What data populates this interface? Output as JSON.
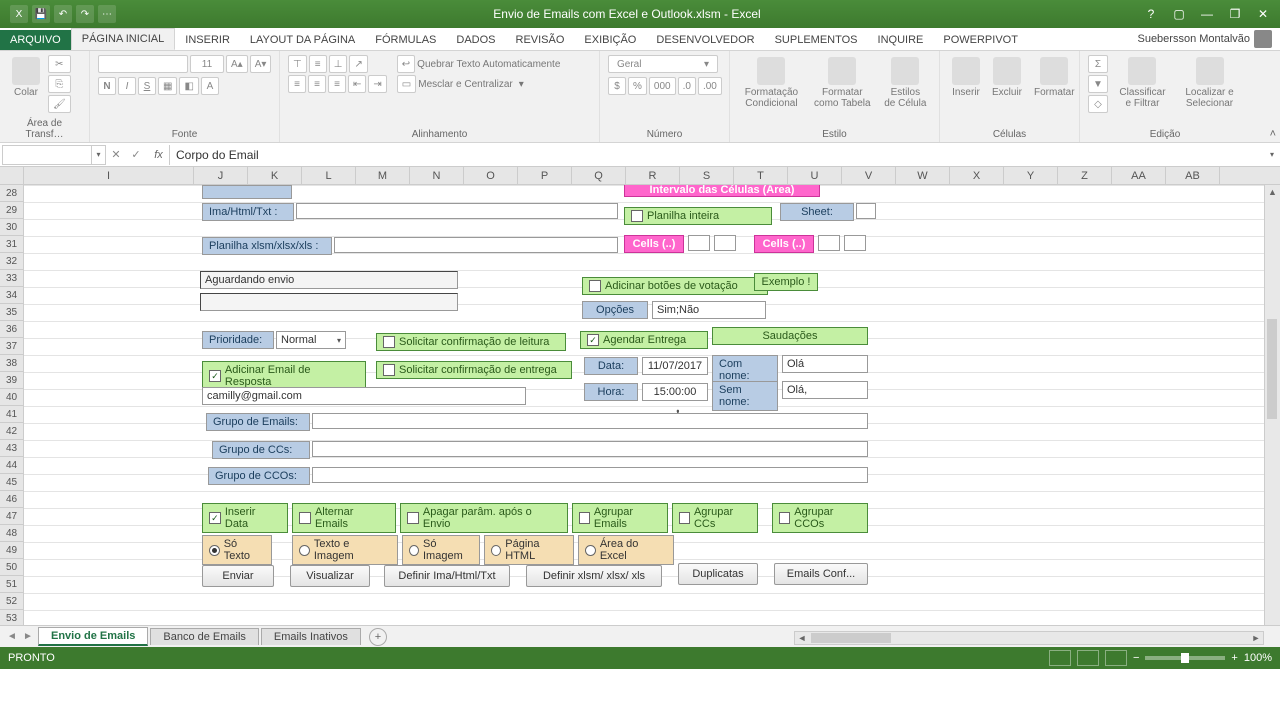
{
  "title": "Envio de Emails com Excel e Outlook.xlsm - Excel",
  "user": "Suebersson Montalvão",
  "tabs": {
    "file": "ARQUIVO",
    "items": [
      "PÁGINA INICIAL",
      "INSERIR",
      "LAYOUT DA PÁGINA",
      "FÓRMULAS",
      "DADOS",
      "REVISÃO",
      "EXIBIÇÃO",
      "DESENVOLVEDOR",
      "SUPLEMENTOS",
      "INQUIRE",
      "POWERPIVOT"
    ],
    "active": 0
  },
  "ribbon": {
    "clipboard": {
      "label": "Área de Transf…",
      "paste": "Colar"
    },
    "font": {
      "label": "Fonte",
      "size": "11"
    },
    "alignment": {
      "label": "Alinhamento",
      "wrap": "Quebrar Texto Automaticamente",
      "merge": "Mesclar e Centralizar"
    },
    "number": {
      "label": "Número",
      "format": "Geral"
    },
    "style": {
      "label": "Estilo",
      "cond": "Formatação Condicional",
      "table": "Formatar como Tabela",
      "cell": "Estilos de Célula"
    },
    "cells": {
      "label": "Células",
      "insert": "Inserir",
      "delete": "Excluir",
      "format": "Formatar"
    },
    "editing": {
      "label": "Edição",
      "sort": "Classificar e Filtrar",
      "find": "Localizar e Selecionar"
    }
  },
  "formula": {
    "namebox": "",
    "value": "Corpo do Email"
  },
  "columns": [
    "I",
    "J",
    "K",
    "L",
    "M",
    "N",
    "O",
    "P",
    "Q",
    "R",
    "S",
    "T",
    "U",
    "V",
    "W",
    "X",
    "Y",
    "Z",
    "AA",
    "AB"
  ],
  "rows_start": 28,
  "rows_end": 53,
  "form": {
    "header_magenta": "Intervalo das Células (Área)",
    "ima_label": "Ima/Html/Txt :",
    "planilha_inteira": "Planilha inteira",
    "sheet_label": "Sheet:",
    "planilha_xlsm": "Planilha xlsm/xlsx/xls :",
    "cells1": "Cells (..)",
    "cells2": "Cells (..)",
    "aguardando": "Aguardando envio",
    "add_botoes": "Adicinar botões de votação",
    "exemplo": "Exemplo !",
    "opcoes": "Opções",
    "simnao": "Sim;Não",
    "prioridade_label": "Prioridade:",
    "prioridade_value": "Normal",
    "solicitar_leitura": "Solicitar confirmação de leitura",
    "agendar_entrega": "Agendar Entrega",
    "saudacoes": "Saudações",
    "add_email_resposta": "Adicinar Email de Resposta",
    "solicitar_entrega": "Solicitar confirmação de entrega",
    "data_label": "Data:",
    "data_value": "11/07/2017",
    "com_nome_label": "Com nome:",
    "com_nome_value": "Olá",
    "hora_label": "Hora:",
    "hora_value": "15:00:00",
    "sem_nome_label": "Sem nome:",
    "sem_nome_value": "Olá,",
    "email_resposta_value": "camilly@gmail.com",
    "grupo_emails": "Grupo de Emails:",
    "grupo_ccs": "Grupo de CCs:",
    "grupo_ccos": "Grupo de CCOs:",
    "inserir_data": "Inserir Data",
    "alternar_emails": "Alternar Emails",
    "apagar_param": "Apagar parâm. após o Envio",
    "agrupar_emails": "Agrupar Emails",
    "agrupar_ccs": "Agrupar CCs",
    "agrupar_ccos": "Agrupar CCOs",
    "so_texto": "Só Texto",
    "texto_imagem": "Texto e Imagem",
    "so_imagem": "Só Imagem",
    "pagina_html": "Página HTML",
    "area_excel": "Área do Excel",
    "enviar": "Enviar",
    "visualizar": "Visualizar",
    "definir_ima": "Definir Ima/Html/Txt",
    "definir_xlsm": "Definir xlsm/ xlsx/ xls",
    "duplicatas": "Duplicatas",
    "emails_conf": "Emails Conf..."
  },
  "sheets": [
    "Envio de Emails",
    "Banco de Emails",
    "Emails Inativos"
  ],
  "active_sheet": 0,
  "status": {
    "ready": "PRONTO",
    "zoom": "100%"
  }
}
